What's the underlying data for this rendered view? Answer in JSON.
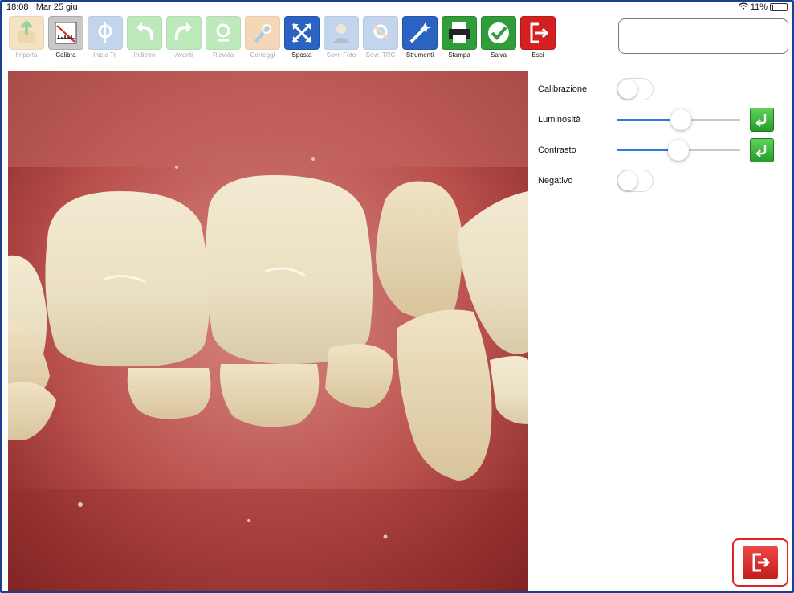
{
  "status": {
    "time": "18:08",
    "date": "Mar 25 giu",
    "battery": "11%",
    "battery_level": 0.11
  },
  "toolbar": {
    "tools": [
      {
        "label": "Importa",
        "icon": "import-icon",
        "enabled": false,
        "color": "#e8c27a"
      },
      {
        "label": "Calibra",
        "icon": "calibrate-icon",
        "enabled": true,
        "color": "#c8c8c8"
      },
      {
        "label": "Inizia Tr.",
        "icon": "start-tracing-icon",
        "enabled": false,
        "color": "#7aa4d8"
      },
      {
        "label": "Indietro",
        "icon": "undo-icon",
        "enabled": false,
        "color": "#6fcf6b"
      },
      {
        "label": "Avanti",
        "icon": "redo-icon",
        "enabled": false,
        "color": "#6fcf6b"
      },
      {
        "label": "Riavvia",
        "icon": "restart-icon",
        "enabled": false,
        "color": "#6fcf6b"
      },
      {
        "label": "Correggi",
        "icon": "correct-icon",
        "enabled": false,
        "color": "#e8a860"
      },
      {
        "label": "Sposta",
        "icon": "move-icon",
        "enabled": true,
        "color": "#2a63c2"
      },
      {
        "label": "Sovr. Foto",
        "icon": "overlay-photo-icon",
        "enabled": false,
        "color": "#7aa4d8"
      },
      {
        "label": "Sovr. TRC",
        "icon": "overlay-trc-icon",
        "enabled": false,
        "color": "#7aa4d8"
      },
      {
        "label": "Strumenti",
        "icon": "tools-wand-icon",
        "enabled": true,
        "color": "#2a63c2"
      },
      {
        "label": "Stampa",
        "icon": "print-icon",
        "enabled": true,
        "color": "#2f9e3a"
      },
      {
        "label": "Salva",
        "icon": "save-check-icon",
        "enabled": true,
        "color": "#2f9e3a"
      },
      {
        "label": "Esci",
        "icon": "exit-icon",
        "enabled": true,
        "color": "#d42020"
      }
    ]
  },
  "search": {
    "value": ""
  },
  "panel": {
    "calibrazione": {
      "label": "Calibrazione",
      "on": false
    },
    "luminosita": {
      "label": "Luminosità",
      "value": 0.52,
      "reset_icon": "reset-arrow-icon"
    },
    "contrasto": {
      "label": "Contrasto",
      "value": 0.5,
      "reset_icon": "reset-arrow-icon"
    },
    "negativo": {
      "label": "Negativo",
      "on": false
    }
  },
  "exit_fab": {
    "icon": "exit-icon",
    "border_color": "#e0202a"
  }
}
